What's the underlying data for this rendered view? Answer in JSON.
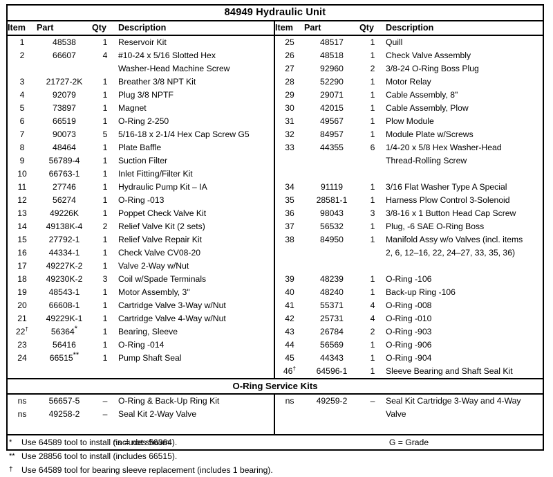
{
  "title": "84949  Hydraulic Unit",
  "columns": {
    "item": "Item",
    "part": "Part",
    "qty": "Qty",
    "description": "Description"
  },
  "left_rows": [
    {
      "item": "1",
      "part": "48538",
      "qty": "1",
      "desc": "Reservoir Kit"
    },
    {
      "item": "2",
      "part": "66607",
      "qty": "4",
      "desc": "#10-24 x 5/16 Slotted Hex",
      "desc2": "Washer-Head Machine Screw"
    },
    {
      "item": "3",
      "part": "21727-2K",
      "qty": "1",
      "desc": "Breather 3/8 NPT Kit"
    },
    {
      "item": "4",
      "part": "92079",
      "qty": "1",
      "desc": "Plug 3/8 NPTF"
    },
    {
      "item": "5",
      "part": "73897",
      "qty": "1",
      "desc": "Magnet"
    },
    {
      "item": "6",
      "part": "66519",
      "qty": "1",
      "desc": "O-Ring 2-250"
    },
    {
      "item": "7",
      "part": "90073",
      "qty": "5",
      "desc": "5/16-18 x 2-1/4 Hex Cap Screw G5"
    },
    {
      "item": "8",
      "part": "48464",
      "qty": "1",
      "desc": "Plate Baffle"
    },
    {
      "item": "9",
      "part": "56789-4",
      "qty": "1",
      "desc": "Suction Filter"
    },
    {
      "item": "10",
      "part": "66763-1",
      "qty": "1",
      "desc": "Inlet Fitting/Filter Kit"
    },
    {
      "item": "11",
      "part": "27746",
      "qty": "1",
      "desc": "Hydraulic Pump Kit – IA"
    },
    {
      "item": "12",
      "part": "56274",
      "qty": "1",
      "desc": "O-Ring -013"
    },
    {
      "item": "13",
      "part": "49226K",
      "qty": "1",
      "desc": "Poppet Check Valve Kit"
    },
    {
      "item": "14",
      "part": "49138K-4",
      "qty": "2",
      "desc": "Relief Valve Kit (2 sets)"
    },
    {
      "item": "15",
      "part": "27792-1",
      "qty": "1",
      "desc": "Relief Valve Repair Kit"
    },
    {
      "item": "16",
      "part": "44334-1",
      "qty": "1",
      "desc": "Check Valve CV08-20"
    },
    {
      "item": "17",
      "part": "49227K-2",
      "qty": "1",
      "desc": "Valve 2-Way w/Nut"
    },
    {
      "item": "18",
      "part": "49230K-2",
      "qty": "3",
      "desc": "Coil w/Spade Terminals"
    },
    {
      "item": "19",
      "part": "48543-1",
      "qty": "1",
      "desc": "Motor Assembly, 3\""
    },
    {
      "item": "20",
      "part": "66608-1",
      "qty": "1",
      "desc": "Cartridge Valve 3-Way w/Nut"
    },
    {
      "item": "21",
      "part": "49229K-1",
      "qty": "1",
      "desc": "Cartridge Valve 4-Way w/Nut"
    },
    {
      "item": "22",
      "item_mark": "†",
      "part": "56364",
      "part_mark": "*",
      "qty": "1",
      "desc": "Bearing, Sleeve"
    },
    {
      "item": "23",
      "part": "56416",
      "qty": "1",
      "desc": "O-Ring -014"
    },
    {
      "item": "24",
      "part": "66515",
      "part_mark": "**",
      "qty": "1",
      "desc": "Pump Shaft Seal"
    }
  ],
  "right_rows": [
    {
      "item": "25",
      "part": "48517",
      "qty": "1",
      "desc": "Quill"
    },
    {
      "item": "26",
      "part": "48518",
      "qty": "1",
      "desc": "Check Valve Assembly"
    },
    {
      "item": "27",
      "part": "92960",
      "qty": "2",
      "desc": "3/8-24 O-Ring Boss Plug"
    },
    {
      "item": "28",
      "part": "52290",
      "qty": "1",
      "desc": "Motor Relay"
    },
    {
      "item": "29",
      "part": "29071",
      "qty": "1",
      "desc": "Cable Assembly, 8\""
    },
    {
      "item": "30",
      "part": "42015",
      "qty": "1",
      "desc": "Cable Assembly, Plow"
    },
    {
      "item": "31",
      "part": "49567",
      "qty": "1",
      "desc": "Plow Module"
    },
    {
      "item": "32",
      "part": "84957",
      "qty": "1",
      "desc": "Module Plate w/Screws"
    },
    {
      "item": "33",
      "part": "44355",
      "qty": "6",
      "desc": "1/4-20 x 5/8 Hex Washer-Head",
      "desc2": "Thread-Rolling Screw"
    },
    {
      "item": "34",
      "part": "91119",
      "qty": "1",
      "desc": "3/16 Flat Washer Type A Special"
    },
    {
      "item": "35",
      "part": "28581-1",
      "qty": "1",
      "desc": "Harness Plow Control 3-Solenoid"
    },
    {
      "item": "36",
      "part": "98043",
      "qty": "3",
      "desc": "3/8-16 x 1 Button Head Cap Screw"
    },
    {
      "item": "37",
      "part": "56532",
      "qty": "1",
      "desc": "Plug, -6 SAE O-Ring Boss"
    },
    {
      "item": "38",
      "part": "84950",
      "qty": "1",
      "desc": "Manifold Assy w/o Valves (incl. items",
      "desc2": "2, 6, 12–16, 22, 24–27, 33, 35, 36)"
    },
    {
      "item": "39",
      "part": "48239",
      "qty": "1",
      "desc": "O-Ring -106"
    },
    {
      "item": "40",
      "part": "48240",
      "qty": "1",
      "desc": "Back-up Ring -106"
    },
    {
      "item": "41",
      "part": "55371",
      "qty": "4",
      "desc": "O-Ring -008"
    },
    {
      "item": "42",
      "part": "25731",
      "qty": "4",
      "desc": "O-Ring -010"
    },
    {
      "item": "43",
      "part": "26784",
      "qty": "2",
      "desc": "O-Ring -903"
    },
    {
      "item": "44",
      "part": "56569",
      "qty": "1",
      "desc": "O-Ring -906"
    },
    {
      "item": "45",
      "part": "44343",
      "qty": "1",
      "desc": "O-Ring -904"
    },
    {
      "item": "46",
      "item_mark": "†",
      "part": "64596-1",
      "qty": "1",
      "desc": "Sleeve Bearing and Shaft Seal Kit"
    }
  ],
  "service_band": "O-Ring Service Kits",
  "service_left_rows": [
    {
      "item": "ns",
      "part": "56657-5",
      "qty": "–",
      "desc": "O-Ring & Back-Up Ring Kit"
    },
    {
      "item": "ns",
      "part": "49258-2",
      "qty": "–",
      "desc": "Seal Kit 2-Way Valve"
    }
  ],
  "service_right_rows": [
    {
      "item": "ns",
      "part": "49259-2",
      "qty": "–",
      "desc": "Seal Kit Cartridge 3-Way and 4-Way",
      "desc2": "Valve"
    }
  ],
  "footer": {
    "left": "ns = not shown",
    "right": "G = Grade"
  },
  "notes": [
    {
      "mark": "*",
      "text": "Use 64589 tool to install (includes 56364)."
    },
    {
      "mark": "**",
      "text": "Use 28856 tool to install (includes 66515)."
    },
    {
      "mark": "†",
      "text": "Use 64589 tool for bearing sleeve replacement (includes 1 bearing)."
    }
  ]
}
